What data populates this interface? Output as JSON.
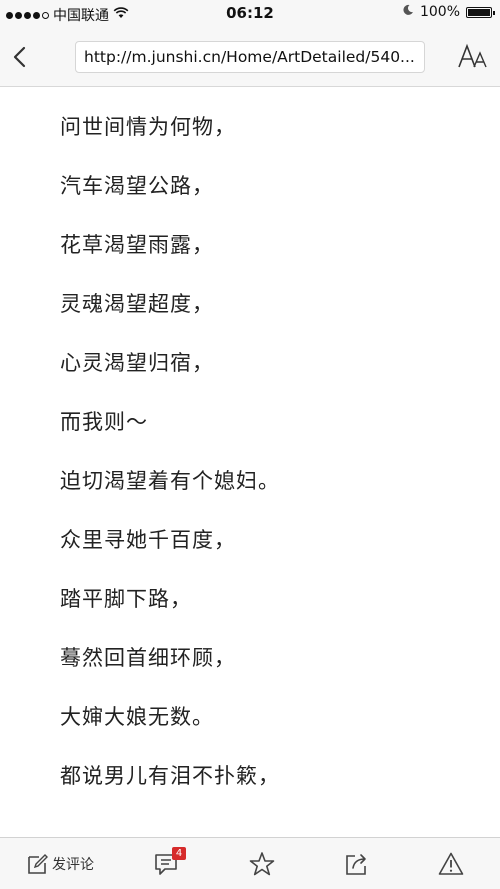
{
  "status_bar": {
    "carrier": "中国联通",
    "time": "06:12",
    "battery": "100%",
    "battery_level": 1.0
  },
  "nav": {
    "url": "http://m.junshi.cn/Home/ArtDetailed/540..."
  },
  "article": {
    "lines": [
      "问世间情为何物，",
      "汽车渴望公路，",
      "花草渴望雨露，",
      "灵魂渴望超度，",
      "心灵渴望归宿，",
      "而我则～",
      "迫切渴望着有个媳妇。",
      "众里寻她千百度，",
      "踏平脚下路，",
      "蓦然回首细环顾，",
      "大婶大娘无数。",
      "都说男儿有泪不扑簌，"
    ]
  },
  "toolbar": {
    "comment_label": "发评论",
    "comment_count": "4"
  },
  "icons": {
    "back": "chevron-left-icon",
    "font": "font-size-icon",
    "comment": "edit-icon",
    "comments": "message-icon",
    "favorite": "star-icon",
    "share": "share-icon",
    "report": "warning-icon"
  }
}
